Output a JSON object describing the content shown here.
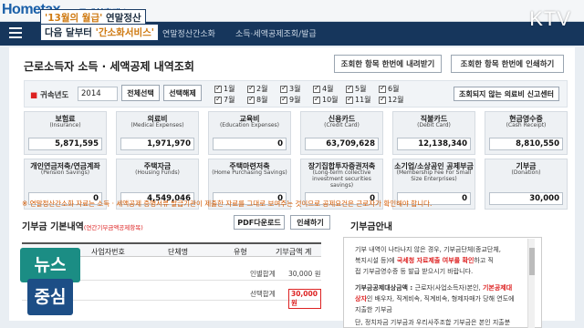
{
  "header": {
    "logo_main": "Hometax",
    "logo_sub": "국세청홈택스",
    "nav": [
      "연말정산간소화",
      "소득·세액공제조회/발급"
    ],
    "caption_line1_quote": "'13월의 월급'",
    "caption_line1_rest": " 연말정산",
    "caption_line2_prefix": "다음 달부터 ",
    "caption_line2_quote": "'간소화서비스'",
    "channel": "KTV"
  },
  "page": {
    "title": "근로소득자 소득 · 세액공제 내역조회",
    "btn_download": "조회한 항목 한번에 내려받기",
    "btn_print": "조회한 항목 한번에 인쇄하기"
  },
  "filter": {
    "label": "귀속년도",
    "year": "2014",
    "btn_select_all": "전체선택",
    "btn_deselect": "선택해제",
    "months": [
      "1월",
      "2월",
      "3월",
      "4월",
      "5월",
      "6월",
      "7월",
      "8월",
      "9월",
      "10월",
      "11월",
      "12월"
    ],
    "btn_report": "조회되지 않는 의료비 신고센터"
  },
  "cards": [
    {
      "title": "보험료",
      "sub": "(Insurance)",
      "value": "5,871,595"
    },
    {
      "title": "의료비",
      "sub": "(Medical Expenses)",
      "value": "1,971,970"
    },
    {
      "title": "교육비",
      "sub": "(Education Expenses)",
      "value": "0"
    },
    {
      "title": "신용카드",
      "sub": "(Credit Card)",
      "value": "63,709,628"
    },
    {
      "title": "직불카드",
      "sub": "(Debit Card)",
      "value": "12,138,340"
    },
    {
      "title": "현금영수증",
      "sub": "(Cash Receipt)",
      "value": "8,810,550"
    },
    {
      "title": "개인연금저축/연금계좌",
      "sub": "(Pension Savings)",
      "value": "0"
    },
    {
      "title": "주택자금",
      "sub": "(Housing Funds)",
      "value": "4,549,046"
    },
    {
      "title": "주택마련저축",
      "sub": "(Home Purchasing Savings)",
      "value": "0"
    },
    {
      "title": "장기집합투자증권저축",
      "sub": "(Long-term collective investment securities savings)",
      "value": "0"
    },
    {
      "title": "소기업/소상공인 공제부금",
      "sub": "(Membership Fee For Small Size Enterprises)",
      "value": "0"
    },
    {
      "title": "기부금",
      "sub": "(Donation)",
      "value": "30,000"
    }
  ],
  "note": "※ 연말정산간소화 자료는 소득 · 세액공제 증명서류 발급기관이 제출한 자료를 그대로 보여주는 것이므로 공제요건은 근로자가 확인해야 합니다.",
  "donation": {
    "title": "기부금 기본내역",
    "title_sub": "(연간기부금액공제항목)",
    "btn_pdf": "PDF다운로드",
    "btn_print": "인쇄하기",
    "columns": [
      "사업자번호",
      "단체명",
      "유형",
      "기부금액 계"
    ],
    "personal_label": "인별합계",
    "personal_value": "30,000 원",
    "selected_label": "선택합계",
    "selected_value": "30,000 원"
  },
  "guide": {
    "title": "기부금안내",
    "line1": "기부 내역이 나타나지 않은 경우, 기부금단체(종교단체,",
    "line2": "복지시설 등)에 ",
    "line2_red": "국세청 자료제출 여부를 확인",
    "line2_end": "하고 직",
    "line3": "접 기부금영수증 등 발급 받으시기 바랍니다.",
    "line4_label": "기부금공제대상금액 : ",
    "line4": "근로자(사업소득자)본인, ",
    "line4_red": "기본공제대",
    "line5_red": "상자",
    "line5": "인 배우자, 직계비속, 직계비속, 형제자매가 당해 연도에",
    "line6": "지출한 기부금",
    "line7": "단, 정치자금 기부금과 우리사주조합 기부금은 본인 지출분"
  },
  "badge": {
    "line1": "뉴스",
    "line2": "중심"
  }
}
